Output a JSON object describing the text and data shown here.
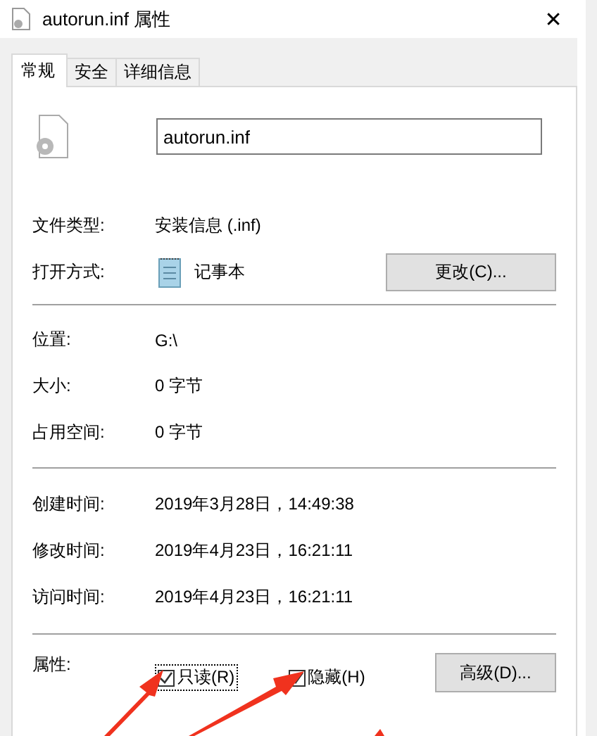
{
  "window": {
    "title": "autorun.inf 属性",
    "close": "✕"
  },
  "tabs": [
    {
      "label": "常规",
      "selected": true
    },
    {
      "label": "安全",
      "selected": false
    },
    {
      "label": "详细信息",
      "selected": false
    }
  ],
  "file_name": {
    "value": "autorun.inf"
  },
  "type_section": [
    {
      "label": "文件类型:",
      "value": "安装信息 (.inf)"
    },
    {
      "label": "打开方式:",
      "value": "记事本",
      "kind": "app",
      "button": "更改(C)..."
    }
  ],
  "location_section": [
    {
      "label": "位置:",
      "value": "G:\\"
    },
    {
      "label": "大小:",
      "value": "0 字节"
    },
    {
      "label": "占用空间:",
      "value": "0 字节"
    }
  ],
  "time_section": [
    {
      "label": "创建时间:",
      "value": "2019年3月28日，14:49:38"
    },
    {
      "label": "修改时间:",
      "value": "2019年4月23日，16:21:11"
    },
    {
      "label": "访问时间:",
      "value": "2019年4月23日，16:21:11"
    }
  ],
  "attributes": {
    "label": "属性:",
    "checkboxes": [
      {
        "label": "只读(R)",
        "checked": true,
        "focused": true
      },
      {
        "label": "隐藏(H)",
        "checked": true,
        "focused": false
      }
    ],
    "button": "高级(D)..."
  }
}
